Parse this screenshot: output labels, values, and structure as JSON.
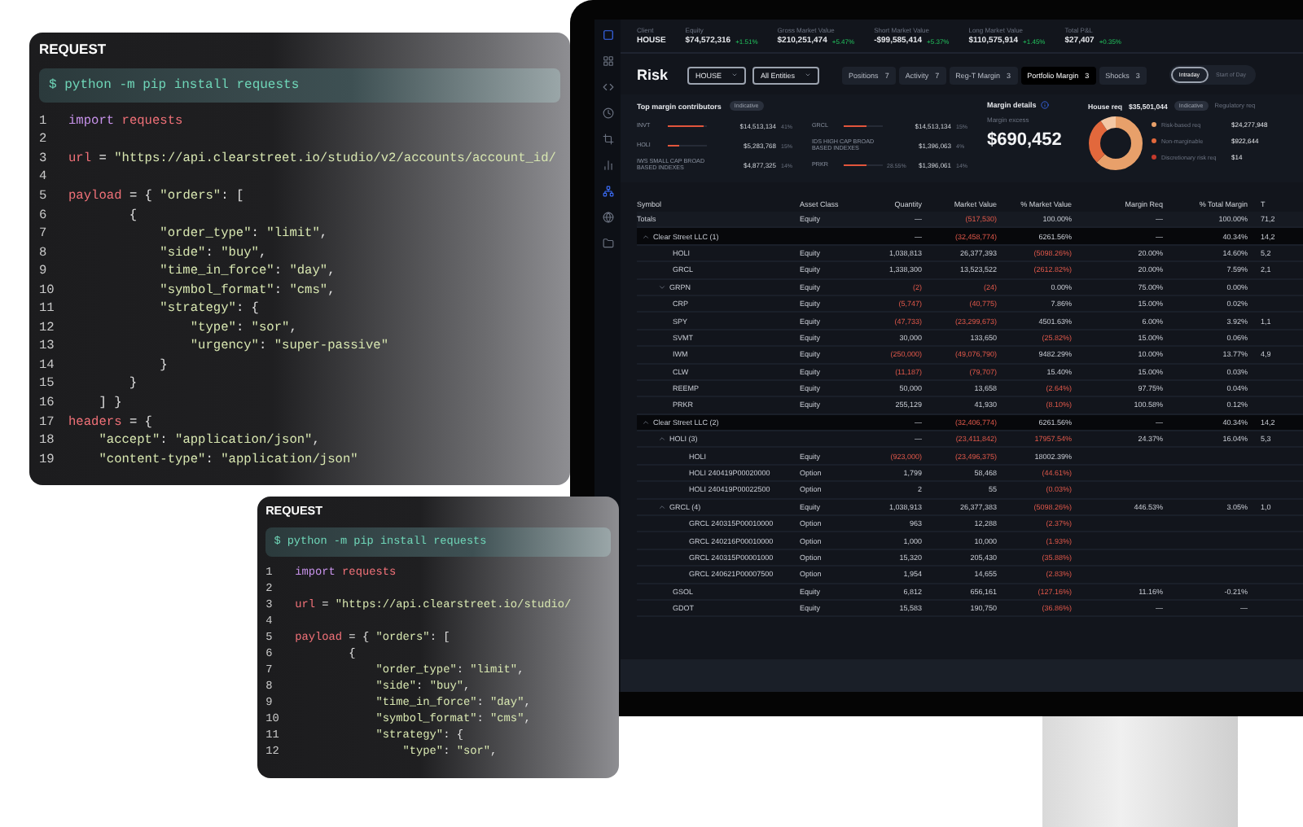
{
  "code_panels": [
    {
      "title": "REQUEST",
      "command": "$ python -m pip install requests",
      "lines": [
        {
          "number": "1",
          "tokens": [
            {
              "kind": "keyword",
              "text": "import "
            },
            {
              "kind": "name",
              "text": "requests"
            }
          ]
        },
        {
          "number": "2"
        },
        {
          "number": "3",
          "tokens": [
            {
              "kind": "name",
              "text": "url"
            },
            {
              "kind": "plain",
              "text": " = "
            },
            {
              "kind": "string",
              "text": "\"https://api.clearstreet.io/studio/v2/accounts/account_id/"
            }
          ]
        },
        {
          "number": "4"
        },
        {
          "number": "5",
          "tokens": [
            {
              "kind": "name",
              "text": "payload"
            },
            {
              "kind": "plain",
              "text": " = { "
            },
            {
              "kind": "string",
              "text": "\"orders\""
            },
            {
              "kind": "plain",
              "text": ": ["
            }
          ]
        },
        {
          "number": "6",
          "tokens": [
            {
              "kind": "plain",
              "text": "        {"
            }
          ]
        },
        {
          "number": "7",
          "tokens": [
            {
              "kind": "string",
              "text": "            \"order_type\""
            },
            {
              "kind": "plain",
              "text": ": "
            },
            {
              "kind": "string",
              "text": "\"limit\""
            },
            {
              "kind": "plain",
              "text": ","
            }
          ]
        },
        {
          "number": "8",
          "tokens": [
            {
              "kind": "string",
              "text": "            \"side\""
            },
            {
              "kind": "plain",
              "text": ": "
            },
            {
              "kind": "string",
              "text": "\"buy\""
            },
            {
              "kind": "plain",
              "text": ","
            }
          ]
        },
        {
          "number": "9",
          "tokens": [
            {
              "kind": "string",
              "text": "            \"time_in_force\""
            },
            {
              "kind": "plain",
              "text": ": "
            },
            {
              "kind": "string",
              "text": "\"day\""
            },
            {
              "kind": "plain",
              "text": ","
            }
          ]
        },
        {
          "number": "10",
          "tokens": [
            {
              "kind": "string",
              "text": "            \"symbol_format\""
            },
            {
              "kind": "plain",
              "text": ": "
            },
            {
              "kind": "string",
              "text": "\"cms\""
            },
            {
              "kind": "plain",
              "text": ","
            }
          ]
        },
        {
          "number": "11",
          "tokens": [
            {
              "kind": "string",
              "text": "            \"strategy\""
            },
            {
              "kind": "plain",
              "text": ": {"
            }
          ]
        },
        {
          "number": "12",
          "tokens": [
            {
              "kind": "string",
              "text": "                \"type\""
            },
            {
              "kind": "plain",
              "text": ": "
            },
            {
              "kind": "string",
              "text": "\"sor\""
            },
            {
              "kind": "plain",
              "text": ","
            }
          ]
        },
        {
          "number": "13",
          "tokens": [
            {
              "kind": "string",
              "text": "                \"urgency\""
            },
            {
              "kind": "plain",
              "text": ": "
            },
            {
              "kind": "string",
              "text": "\"super-passive\""
            }
          ]
        },
        {
          "number": "14",
          "tokens": [
            {
              "kind": "plain",
              "text": "            }"
            }
          ]
        },
        {
          "number": "15",
          "tokens": [
            {
              "kind": "plain",
              "text": "        }"
            }
          ]
        },
        {
          "number": "16",
          "tokens": [
            {
              "kind": "plain",
              "text": "    ] }"
            }
          ]
        },
        {
          "number": "17",
          "tokens": [
            {
              "kind": "name",
              "text": "headers"
            },
            {
              "kind": "plain",
              "text": " = {"
            }
          ]
        },
        {
          "number": "18",
          "tokens": [
            {
              "kind": "string",
              "text": "    \"accept\""
            },
            {
              "kind": "plain",
              "text": ": "
            },
            {
              "kind": "string",
              "text": "\"application/json\""
            },
            {
              "kind": "plain",
              "text": ","
            }
          ]
        },
        {
          "number": "19",
          "tokens": [
            {
              "kind": "string",
              "text": "    \"content-type\""
            },
            {
              "kind": "plain",
              "text": ": "
            },
            {
              "kind": "string",
              "text": "\"application/json\""
            }
          ]
        }
      ]
    },
    {
      "title": "REQUEST",
      "command": "$ python -m pip install requests",
      "lines": [
        {
          "number": "1",
          "tokens": [
            {
              "kind": "keyword",
              "text": "import "
            },
            {
              "kind": "name",
              "text": "requests"
            }
          ]
        },
        {
          "number": "2"
        },
        {
          "number": "3",
          "tokens": [
            {
              "kind": "name",
              "text": "url"
            },
            {
              "kind": "plain",
              "text": " = "
            },
            {
              "kind": "string",
              "text": "\"https://api.clearstreet.io/studio/"
            }
          ]
        },
        {
          "number": "4"
        },
        {
          "number": "5",
          "tokens": [
            {
              "kind": "name",
              "text": "payload"
            },
            {
              "kind": "plain",
              "text": " = { "
            },
            {
              "kind": "string",
              "text": "\"orders\""
            },
            {
              "kind": "plain",
              "text": ": ["
            }
          ]
        },
        {
          "number": "6",
          "tokens": [
            {
              "kind": "plain",
              "text": "        {"
            }
          ]
        },
        {
          "number": "7",
          "tokens": [
            {
              "kind": "string",
              "text": "            \"order_type\""
            },
            {
              "kind": "plain",
              "text": ": "
            },
            {
              "kind": "string",
              "text": "\"limit\""
            },
            {
              "kind": "plain",
              "text": ","
            }
          ]
        },
        {
          "number": "8",
          "tokens": [
            {
              "kind": "string",
              "text": "            \"side\""
            },
            {
              "kind": "plain",
              "text": ": "
            },
            {
              "kind": "string",
              "text": "\"buy\""
            },
            {
              "kind": "plain",
              "text": ","
            }
          ]
        },
        {
          "number": "9",
          "tokens": [
            {
              "kind": "string",
              "text": "            \"time_in_force\""
            },
            {
              "kind": "plain",
              "text": ": "
            },
            {
              "kind": "string",
              "text": "\"day\""
            },
            {
              "kind": "plain",
              "text": ","
            }
          ]
        },
        {
          "number": "10",
          "tokens": [
            {
              "kind": "string",
              "text": "            \"symbol_format\""
            },
            {
              "kind": "plain",
              "text": ": "
            },
            {
              "kind": "string",
              "text": "\"cms\""
            },
            {
              "kind": "plain",
              "text": ","
            }
          ]
        },
        {
          "number": "11",
          "tokens": [
            {
              "kind": "string",
              "text": "            \"strategy\""
            },
            {
              "kind": "plain",
              "text": ": {"
            }
          ]
        },
        {
          "number": "12",
          "tokens": [
            {
              "kind": "string",
              "text": "                \"type\""
            },
            {
              "kind": "plain",
              "text": ": "
            },
            {
              "kind": "string",
              "text": "\"sor\""
            },
            {
              "kind": "plain",
              "text": ","
            }
          ]
        }
      ]
    }
  ],
  "app": {
    "stats": [
      {
        "label": "Client",
        "value": "HOUSE"
      },
      {
        "label": "Equity",
        "value": "$74,572,316",
        "change": "+1.51%"
      },
      {
        "label": "Gross Market Value",
        "value": "$210,251,474",
        "change": "+5.47%"
      },
      {
        "label": "Short Market Value",
        "value": "-$99,585,414",
        "change": "+5.37%"
      },
      {
        "label": "Long Market Value",
        "value": "$110,575,914",
        "change": "+1.45%"
      },
      {
        "label": "Total P&L",
        "value": "$27,407",
        "change": "+0.35%"
      }
    ],
    "header": {
      "title": "Risk",
      "selects": [
        "HOUSE",
        "All Entities"
      ],
      "tabs": [
        {
          "label": "Positions",
          "count": "7",
          "selected": false
        },
        {
          "label": "Activity",
          "count": "7",
          "selected": false
        },
        {
          "label": "Reg-T Margin",
          "count": "3",
          "selected": false
        },
        {
          "label": "Portfolio Margin",
          "count": "3",
          "selected": true
        },
        {
          "label": "Shocks",
          "count": "3",
          "selected": false
        }
      ],
      "toggle": [
        {
          "label": "Intraday",
          "selected": true
        },
        {
          "label": "Start of Day",
          "selected": false
        }
      ]
    },
    "contributors": {
      "title": "Top margin contributors",
      "badge": "Indicative",
      "columns": [
        [
          {
            "name": "INVT",
            "level": 0.9,
            "amount": "$14,513,134",
            "share": "41%"
          },
          {
            "name": "HOLI",
            "level": 0.3,
            "amount": "$5,283,768",
            "share": "15%"
          },
          {
            "name": "IWS SMALL CAP BROAD BASED INDEXES",
            "amount": "$4,877,325",
            "share": "14%"
          }
        ],
        [
          {
            "name": "GRCL",
            "level": 0.6,
            "amount": "$14,513,134",
            "share": "15%"
          },
          {
            "name": "IDS HIGH CAP BROAD BASED INDEXES",
            "amount": "$1,396,063",
            "share": "4%"
          },
          {
            "name": "PRKR",
            "level": 0.6,
            "bar_label": "28.55%",
            "amount": "$1,396,061",
            "share": "14%"
          }
        ]
      ]
    },
    "margin": {
      "title": "Margin details",
      "excess_label": "Margin excess",
      "excess": "$690,452",
      "house_label": "House req",
      "house": "$35,501,044",
      "badge": "Indicative",
      "regulatory_label": "Regulatory req",
      "legend": [
        {
          "label": "Risk-based req",
          "value": "$24,277,948",
          "color": "#e8a06a"
        },
        {
          "label": "Non-marginable",
          "value": "$922,644",
          "color": "#e2683c"
        },
        {
          "label": "Discretionary risk req",
          "value": "$14",
          "color": "#c43a2c"
        }
      ]
    },
    "table": {
      "columns": [
        "Symbol",
        "Asset Class",
        "Quantity",
        "Market Value",
        "% Market Value",
        "Margin Req",
        "% Total Margin",
        "T"
      ],
      "rows": [
        {
          "kind": "total",
          "cells": [
            {
              "text": "Totals",
              "negative": false
            },
            {
              "text": "Equity",
              "negative": false
            },
            {
              "text": "—",
              "negative": false
            },
            {
              "text": "(517,530)",
              "negative": true
            },
            {
              "text": "100.00%",
              "negative": false
            },
            {
              "text": "—",
              "negative": false
            },
            {
              "text": "100.00%",
              "negative": false
            },
            {
              "text": "71,2",
              "negative": false
            }
          ]
        },
        {
          "kind": "group",
          "expanded": true,
          "cells": [
            {
              "text": "Clear Street LLC (1)",
              "negative": false
            },
            null,
            {
              "text": "—",
              "negative": false
            },
            {
              "text": "(32,458,774)",
              "negative": true
            },
            {
              "text": "6261.56%",
              "negative": false
            },
            {
              "text": "—",
              "negative": false
            },
            {
              "text": "40.34%",
              "negative": false
            },
            {
              "text": "14,2",
              "negative": false
            }
          ],
          "children": [
            {
              "kind": "position",
              "cells": [
                {
                  "text": "HOLI",
                  "negative": false
                },
                {
                  "text": "Equity",
                  "negative": false
                },
                {
                  "text": "1,038,813",
                  "negative": false
                },
                {
                  "text": "26,377,393",
                  "negative": false
                },
                {
                  "text": "(5098.26%)",
                  "negative": true
                },
                {
                  "text": "20.00%",
                  "negative": false
                },
                {
                  "text": "14.60%",
                  "negative": false
                },
                {
                  "text": "5,2",
                  "negative": false
                }
              ]
            },
            {
              "kind": "position",
              "cells": [
                {
                  "text": "GRCL",
                  "negative": false
                },
                {
                  "text": "Equity",
                  "negative": false
                },
                {
                  "text": "1,338,300",
                  "negative": false
                },
                {
                  "text": "13,523,522",
                  "negative": false
                },
                {
                  "text": "(2612.82%)",
                  "negative": true
                },
                {
                  "text": "20.00%",
                  "negative": false
                },
                {
                  "text": "7.59%",
                  "negative": false
                },
                {
                  "text": "2,1",
                  "negative": false
                }
              ]
            },
            {
              "kind": "position",
              "expanded": false,
              "cells": [
                {
                  "text": "GRPN",
                  "negative": false
                },
                {
                  "text": "Equity",
                  "negative": false
                },
                {
                  "text": "(2)",
                  "negative": true
                },
                {
                  "text": "(24)",
                  "negative": true
                },
                {
                  "text": "0.00%",
                  "negative": false
                },
                {
                  "text": "75.00%",
                  "negative": false
                },
                {
                  "text": "0.00%",
                  "negative": false
                },
                null
              ]
            },
            {
              "kind": "position",
              "cells": [
                {
                  "text": "CRP",
                  "negative": false
                },
                {
                  "text": "Equity",
                  "negative": false
                },
                {
                  "text": "(5,747)",
                  "negative": true
                },
                {
                  "text": "(40,775)",
                  "negative": true
                },
                {
                  "text": "7.86%",
                  "negative": false
                },
                {
                  "text": "15.00%",
                  "negative": false
                },
                {
                  "text": "0.02%",
                  "negative": false
                },
                null
              ]
            },
            {
              "kind": "position",
              "cells": [
                {
                  "text": "SPY",
                  "negative": false
                },
                {
                  "text": "Equity",
                  "negative": false
                },
                {
                  "text": "(47,733)",
                  "negative": true
                },
                {
                  "text": "(23,299,673)",
                  "negative": true
                },
                {
                  "text": "4501.63%",
                  "negative": false
                },
                {
                  "text": "6.00%",
                  "negative": false
                },
                {
                  "text": "3.92%",
                  "negative": false
                },
                {
                  "text": "1,1",
                  "negative": false
                }
              ]
            },
            {
              "kind": "position",
              "cells": [
                {
                  "text": "SVMT",
                  "negative": false
                },
                {
                  "text": "Equity",
                  "negative": false
                },
                {
                  "text": "30,000",
                  "negative": false
                },
                {
                  "text": "133,650",
                  "negative": false
                },
                {
                  "text": "(25.82%)",
                  "negative": true
                },
                {
                  "text": "15.00%",
                  "negative": false
                },
                {
                  "text": "0.06%",
                  "negative": false
                },
                null
              ]
            },
            {
              "kind": "position",
              "cells": [
                {
                  "text": "IWM",
                  "negative": false
                },
                {
                  "text": "Equity",
                  "negative": false
                },
                {
                  "text": "(250,000)",
                  "negative": true
                },
                {
                  "text": "(49,076,790)",
                  "negative": true
                },
                {
                  "text": "9482.29%",
                  "negative": false
                },
                {
                  "text": "10.00%",
                  "negative": false
                },
                {
                  "text": "13.77%",
                  "negative": false
                },
                {
                  "text": "4,9",
                  "negative": false
                }
              ]
            },
            {
              "kind": "position",
              "cells": [
                {
                  "text": "CLW",
                  "negative": false
                },
                {
                  "text": "Equity",
                  "negative": false
                },
                {
                  "text": "(11,187)",
                  "negative": true
                },
                {
                  "text": "(79,707)",
                  "negative": true
                },
                {
                  "text": "15.40%",
                  "negative": false
                },
                {
                  "text": "15.00%",
                  "negative": false
                },
                {
                  "text": "0.03%",
                  "negative": false
                },
                null
              ]
            },
            {
              "kind": "position",
              "cells": [
                {
                  "text": "REEMP",
                  "negative": false
                },
                {
                  "text": "Equity",
                  "negative": false
                },
                {
                  "text": "50,000",
                  "negative": false
                },
                {
                  "text": "13,658",
                  "negative": false
                },
                {
                  "text": "(2.64%)",
                  "negative": true
                },
                {
                  "text": "97.75%",
                  "negative": false
                },
                {
                  "text": "0.04%",
                  "negative": false
                },
                null
              ]
            },
            {
              "kind": "position",
              "cells": [
                {
                  "text": "PRKR",
                  "negative": false
                },
                {
                  "text": "Equity",
                  "negative": false
                },
                {
                  "text": "255,129",
                  "negative": false
                },
                {
                  "text": "41,930",
                  "negative": false
                },
                {
                  "text": "(8.10%)",
                  "negative": true
                },
                {
                  "text": "100.58%",
                  "negative": false
                },
                {
                  "text": "0.12%",
                  "negative": false
                },
                null
              ]
            }
          ]
        },
        {
          "kind": "group",
          "expanded": true,
          "cells": [
            {
              "text": "Clear Street LLC (2)",
              "negative": false
            },
            null,
            {
              "text": "—",
              "negative": false
            },
            {
              "text": "(32,406,774)",
              "negative": true
            },
            {
              "text": "6261.56%",
              "negative": false
            },
            {
              "text": "—",
              "negative": false
            },
            {
              "text": "40.34%",
              "negative": false
            },
            {
              "text": "14,2",
              "negative": false
            }
          ],
          "children": [
            {
              "kind": "position",
              "expanded": true,
              "cells": [
                {
                  "text": "HOLI (3)",
                  "negative": false
                },
                null,
                {
                  "text": "—",
                  "negative": false
                },
                {
                  "text": "(23,411,842)",
                  "negative": true
                },
                {
                  "text": "17957.54%",
                  "negative": true
                },
                {
                  "text": "24.37%",
                  "negative": false
                },
                {
                  "text": "16.04%",
                  "negative": false
                },
                {
                  "text": "5,3",
                  "negative": false
                }
              ],
              "children": [
                {
                  "kind": "position",
                  "cells": [
                    {
                      "text": "HOLI",
                      "negative": false
                    },
                    {
                      "text": "Equity",
                      "negative": false
                    },
                    {
                      "text": "(923,000)",
                      "negative": true
                    },
                    {
                      "text": "(23,496,375)",
                      "negative": true
                    },
                    {
                      "text": "18002.39%",
                      "negative": false
                    },
                    null,
                    null,
                    null
                  ]
                },
                {
                  "kind": "position",
                  "cells": [
                    {
                      "text": "HOLI 240419P00020000",
                      "negative": false
                    },
                    {
                      "text": "Option",
                      "negative": false
                    },
                    {
                      "text": "1,799",
                      "negative": false
                    },
                    {
                      "text": "58,468",
                      "negative": false
                    },
                    {
                      "text": "(44.61%)",
                      "negative": true
                    },
                    null,
                    null,
                    null
                  ]
                },
                {
                  "kind": "position",
                  "cells": [
                    {
                      "text": "HOLI 240419P00022500",
                      "negative": false
                    },
                    {
                      "text": "Option",
                      "negative": false
                    },
                    {
                      "text": "2",
                      "negative": false
                    },
                    {
                      "text": "55",
                      "negative": false
                    },
                    {
                      "text": "(0.03%)",
                      "negative": true
                    },
                    null,
                    null,
                    null
                  ]
                }
              ]
            },
            {
              "kind": "position",
              "expanded": true,
              "cells": [
                {
                  "text": "GRCL (4)",
                  "negative": false
                },
                {
                  "text": "Equity",
                  "negative": false
                },
                {
                  "text": "1,038,913",
                  "negative": false
                },
                {
                  "text": "26,377,383",
                  "negative": false
                },
                {
                  "text": "(5098.26%)",
                  "negative": true
                },
                {
                  "text": "446.53%",
                  "negative": false
                },
                {
                  "text": "3.05%",
                  "negative": false
                },
                {
                  "text": "1,0",
                  "negative": false
                }
              ],
              "children": [
                {
                  "kind": "position",
                  "cells": [
                    {
                      "text": "GRCL 240315P00010000",
                      "negative": false
                    },
                    {
                      "text": "Option",
                      "negative": false
                    },
                    {
                      "text": "963",
                      "negative": false
                    },
                    {
                      "text": "12,288",
                      "negative": false
                    },
                    {
                      "text": "(2.37%)",
                      "negative": true
                    },
                    null,
                    null,
                    null
                  ]
                },
                {
                  "kind": "position",
                  "cells": [
                    {
                      "text": "GRCL 240216P00010000",
                      "negative": false
                    },
                    {
                      "text": "Option",
                      "negative": false
                    },
                    {
                      "text": "1,000",
                      "negative": false
                    },
                    {
                      "text": "10,000",
                      "negative": false
                    },
                    {
                      "text": "(1.93%)",
                      "negative": true
                    },
                    null,
                    null,
                    null
                  ]
                },
                {
                  "kind": "position",
                  "cells": [
                    {
                      "text": "GRCL 240315P00001000",
                      "negative": false
                    },
                    {
                      "text": "Option",
                      "negative": false
                    },
                    {
                      "text": "15,320",
                      "negative": false
                    },
                    {
                      "text": "205,430",
                      "negative": false
                    },
                    {
                      "text": "(35.88%)",
                      "negative": true
                    },
                    null,
                    null,
                    null
                  ]
                },
                {
                  "kind": "position",
                  "cells": [
                    {
                      "text": "GRCL 240621P00007500",
                      "negative": false
                    },
                    {
                      "text": "Option",
                      "negative": false
                    },
                    {
                      "text": "1,954",
                      "negative": false
                    },
                    {
                      "text": "14,655",
                      "negative": false
                    },
                    {
                      "text": "(2.83%)",
                      "negative": true
                    },
                    null,
                    null,
                    null
                  ]
                }
              ]
            },
            {
              "kind": "position",
              "cells": [
                {
                  "text": "GSOL",
                  "negative": false
                },
                {
                  "text": "Equity",
                  "negative": false
                },
                {
                  "text": "6,812",
                  "negative": false
                },
                {
                  "text": "656,161",
                  "negative": false
                },
                {
                  "text": "(127.16%)",
                  "negative": true
                },
                {
                  "text": "11.16%",
                  "negative": false
                },
                {
                  "text": "-0.21%",
                  "negative": false
                },
                null
              ]
            },
            {
              "kind": "position",
              "cells": [
                {
                  "text": "GDOT",
                  "negative": false
                },
                {
                  "text": "Equity",
                  "negative": false
                },
                {
                  "text": "15,583",
                  "negative": false
                },
                {
                  "text": "190,750",
                  "negative": false
                },
                {
                  "text": "(36.86%)",
                  "negative": true
                },
                {
                  "text": "—",
                  "negative": false
                },
                {
                  "text": "—",
                  "negative": false
                },
                null
              ]
            }
          ]
        }
      ]
    }
  }
}
